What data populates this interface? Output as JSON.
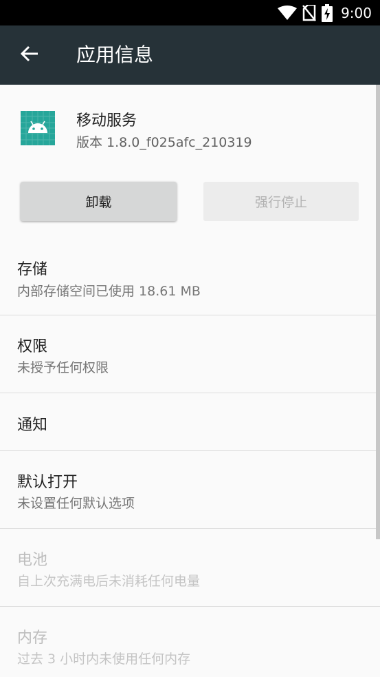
{
  "status_bar": {
    "time": "9:00",
    "icons": [
      "wifi-icon",
      "no-sim-icon",
      "battery-charging-icon"
    ]
  },
  "app_bar": {
    "title": "应用信息",
    "back_icon": "arrow-back-icon"
  },
  "app": {
    "name": "移动服务",
    "version": "版本 1.8.0_f025afc_210319",
    "icon": "android-icon",
    "icon_color": "#26a69a"
  },
  "buttons": {
    "uninstall": "卸载",
    "force_stop": "强行停止"
  },
  "items": [
    {
      "title": "存储",
      "subtitle": "内部存储空间已使用 18.61 MB",
      "enabled": true
    },
    {
      "title": "权限",
      "subtitle": "未授予任何权限",
      "enabled": true
    },
    {
      "title": "通知",
      "subtitle": "",
      "enabled": true
    },
    {
      "title": "默认打开",
      "subtitle": "未设置任何默认选项",
      "enabled": true
    },
    {
      "title": "电池",
      "subtitle": "自上次充满电后未消耗任何电量",
      "enabled": false
    },
    {
      "title": "内存",
      "subtitle": "过去 3 小时内未使用任何内存",
      "enabled": false
    }
  ],
  "colors": {
    "app_bar": "#263238",
    "status_bar": "#000000",
    "background": "#fafafa"
  }
}
